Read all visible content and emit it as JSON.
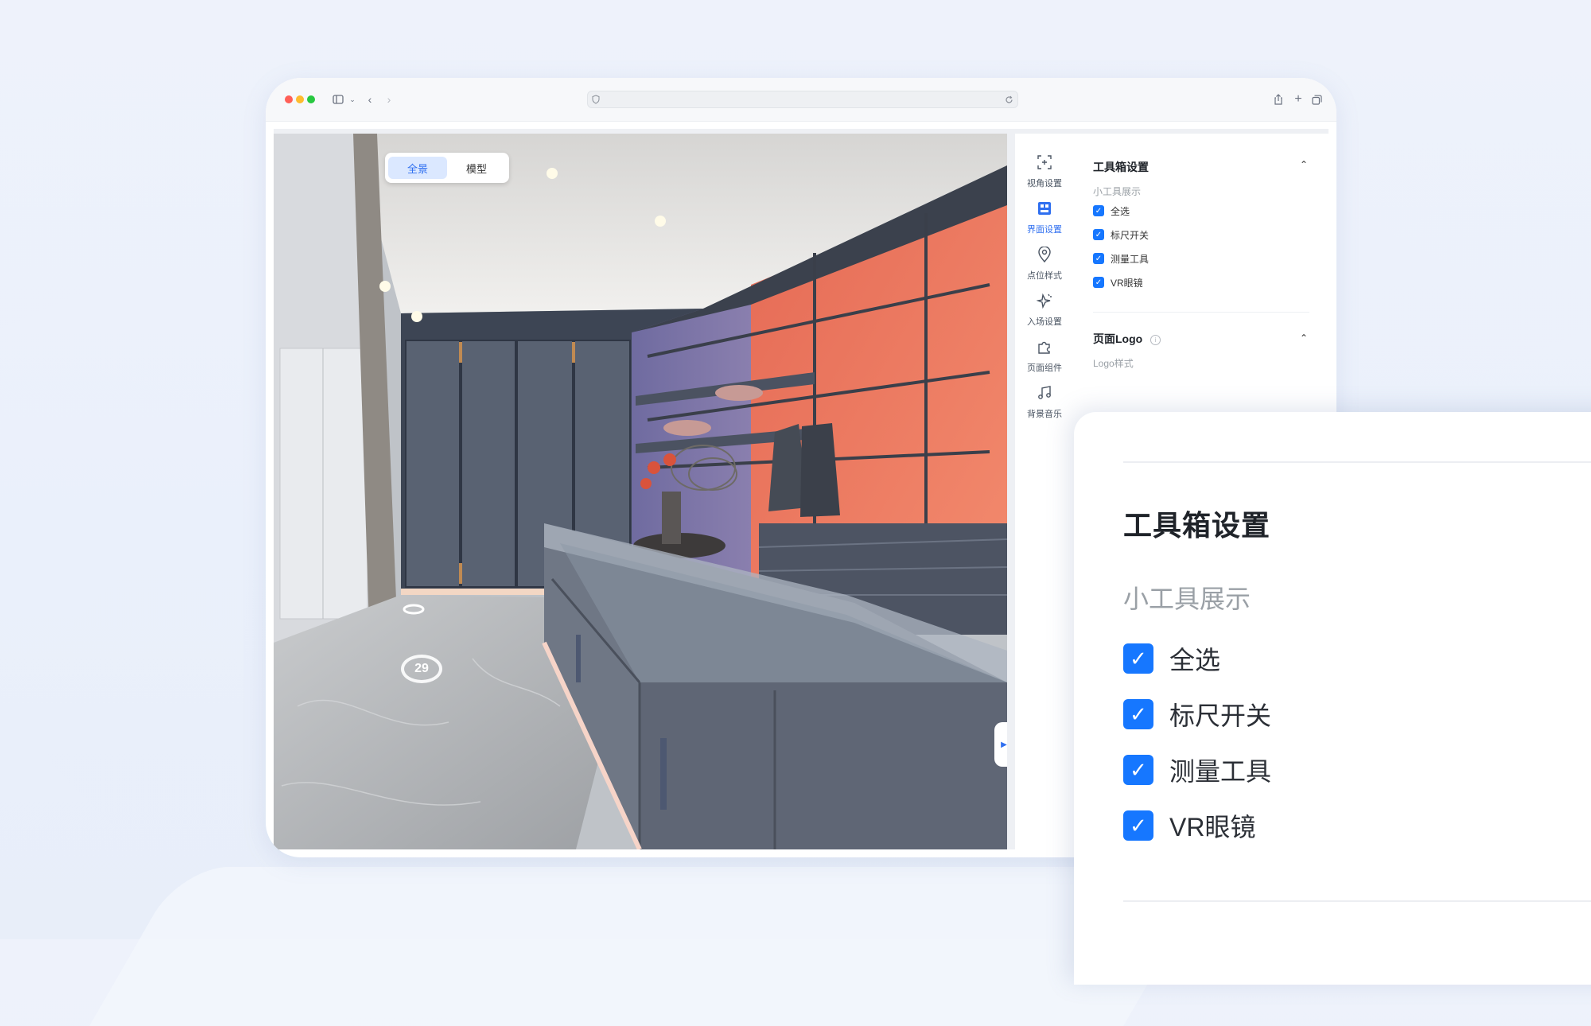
{
  "browser": {
    "traffic_lights": {
      "close": "#ff5f57",
      "minimize": "#febc2e",
      "maximize": "#28c840"
    },
    "icons": [
      "sidebar-icon",
      "chevron-down-icon",
      "back-icon",
      "forward-icon",
      "shield-icon",
      "reload-icon",
      "share-icon",
      "new-tab-icon",
      "tabs-icon"
    ]
  },
  "viewer": {
    "mode_toggle": [
      {
        "label": "全景",
        "active": true
      },
      {
        "label": "模型",
        "active": false
      }
    ],
    "hotspot_number": "29"
  },
  "sidenav": {
    "items": [
      {
        "label": "视角设置",
        "icon": "view-angle-icon",
        "active": false
      },
      {
        "label": "界面设置",
        "icon": "interface-icon",
        "active": true
      },
      {
        "label": "点位样式",
        "icon": "location-pin-icon",
        "active": false
      },
      {
        "label": "入场设置",
        "icon": "entry-icon",
        "active": false
      },
      {
        "label": "页面组件",
        "icon": "puzzle-icon",
        "active": false
      },
      {
        "label": "背景音乐",
        "icon": "music-icon",
        "active": false
      }
    ]
  },
  "panel": {
    "toolbox": {
      "title": "工具箱设置",
      "subtitle": "小工具展示",
      "options": [
        {
          "label": "全选",
          "checked": true
        },
        {
          "label": "标尺开关",
          "checked": true
        },
        {
          "label": "测量工具",
          "checked": true
        },
        {
          "label": "VR眼镜",
          "checked": true
        }
      ]
    },
    "logo": {
      "title": "页面Logo",
      "subtitle": "Logo样式"
    }
  },
  "zoom": {
    "title": "工具箱设置",
    "subtitle": "小工具展示",
    "options": [
      {
        "label": "全选"
      },
      {
        "label": "标尺开关"
      },
      {
        "label": "测量工具"
      },
      {
        "label": "VR眼镜"
      }
    ]
  },
  "colors": {
    "accent": "#1677ff",
    "accent_light": "#dbe8ff",
    "wall_orange": "#f0755a",
    "wall_purple": "#7b74a8",
    "cabinet": "#5a6272"
  }
}
